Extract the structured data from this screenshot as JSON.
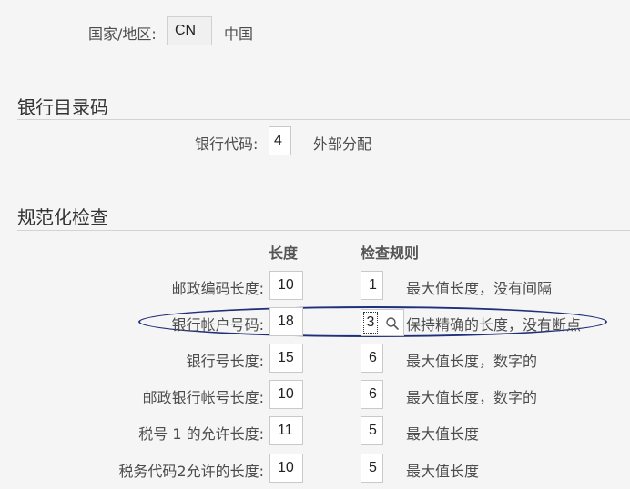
{
  "header": {
    "country_label": "国家/地区:",
    "country_code": "CN",
    "country_name": "中国"
  },
  "bank_directory": {
    "title": "银行目录码",
    "bank_code_label": "银行代码:",
    "bank_code_value": "4",
    "bank_code_desc": "外部分配"
  },
  "checks": {
    "title": "规范化检查",
    "col_length": "长度",
    "col_rule": "检查规则",
    "rows": [
      {
        "label": "邮政编码长度:",
        "length": "10",
        "rule": "1",
        "rule_desc": "最大值长度，没有间隔"
      },
      {
        "label": "银行帐户号码:",
        "length": "18",
        "rule": "3",
        "rule_desc": "保持精确的长度，没有断点"
      },
      {
        "label": "银行号长度:",
        "length": "15",
        "rule": "6",
        "rule_desc": "最大值长度，数字的"
      },
      {
        "label": "邮政银行帐号长度:",
        "length": "10",
        "rule": "6",
        "rule_desc": "最大值长度，数字的"
      },
      {
        "label": "税号 1 的允许长度:",
        "length": "11",
        "rule": "5",
        "rule_desc": "最大值长度"
      },
      {
        "label": "税务代码2允许的长度:",
        "length": "10",
        "rule": "5",
        "rule_desc": "最大值长度"
      }
    ]
  },
  "colors": {
    "highlight_ellipse": "#1f2f7a",
    "background": "#f5f5f5"
  }
}
